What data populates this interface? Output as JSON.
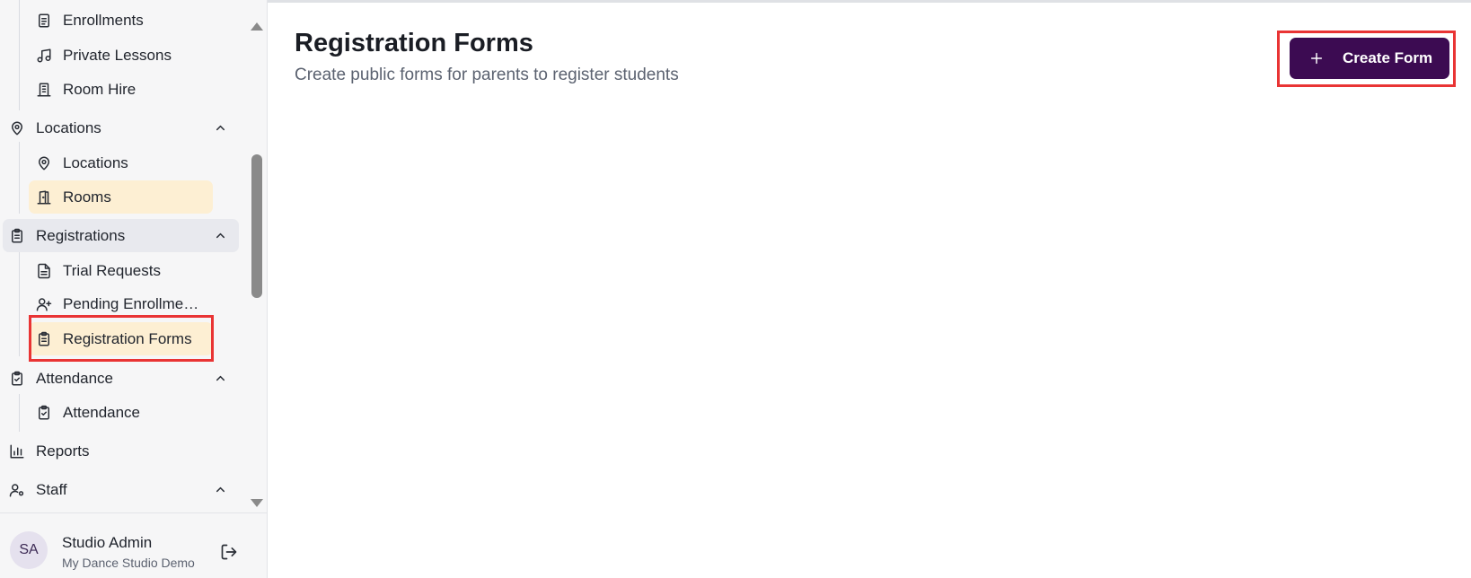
{
  "header": {
    "title": "Registration Forms",
    "subtitle": "Create public forms for parents to register students",
    "create_label": "Create Form"
  },
  "sidebar": {
    "items": {
      "enrollments": "Enrollments",
      "private_lessons": "Private Lessons",
      "room_hire": "Room Hire",
      "locations_group": "Locations",
      "locations": "Locations",
      "rooms": "Rooms",
      "registrations_group": "Registrations",
      "trial_requests": "Trial Requests",
      "pending_enrollments": "Pending Enrollments",
      "registration_forms": "Registration Forms",
      "attendance_group": "Attendance",
      "attendance": "Attendance",
      "reports": "Reports",
      "staff_group": "Staff"
    }
  },
  "user": {
    "initials": "SA",
    "name": "Studio Admin",
    "org": "My Dance Studio Demo"
  },
  "colors": {
    "accent": "#3c0b52",
    "active_item": "#fdefd3",
    "active_group": "#e8e9ee",
    "highlight": "#e93434"
  }
}
